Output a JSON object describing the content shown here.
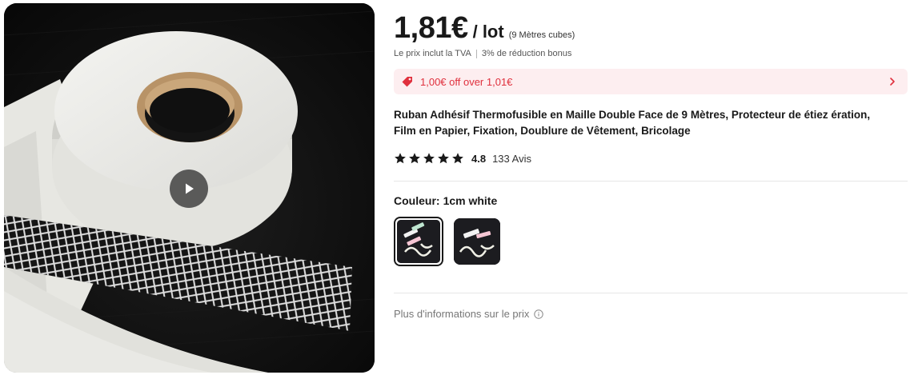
{
  "gallery": {
    "image_alt": "white fusible tape roll",
    "play_icon": "play-icon"
  },
  "price": {
    "amount": "1,81€",
    "unit": "/ lot",
    "quantity": "(9 Mètres cubes)"
  },
  "vat": {
    "included": "Le prix inclut la TVA",
    "bonus": "3% de réduction bonus"
  },
  "coupon": {
    "icon": "tag-icon",
    "text": "1,00€ off over 1,01€",
    "accent": "#e0303d",
    "background": "#fdeef0"
  },
  "product": {
    "title": "Ruban Adhésif Thermofusible en Maille Double Face de 9 Mètres, Protecteur de étiez ération, Film en Papier, Fixation, Doublure de Vêtement, Bricolage"
  },
  "rating": {
    "stars": 5,
    "value": "4.8",
    "reviews": "133 Avis"
  },
  "color": {
    "label": "Couleur:",
    "value": "1cm white",
    "options": [
      {
        "name": "1cm white",
        "selected": true
      },
      {
        "name": "variant 2",
        "selected": false
      }
    ]
  },
  "more_info": {
    "text": "Plus d'informations sur le prix",
    "icon": "info-circle-icon"
  }
}
